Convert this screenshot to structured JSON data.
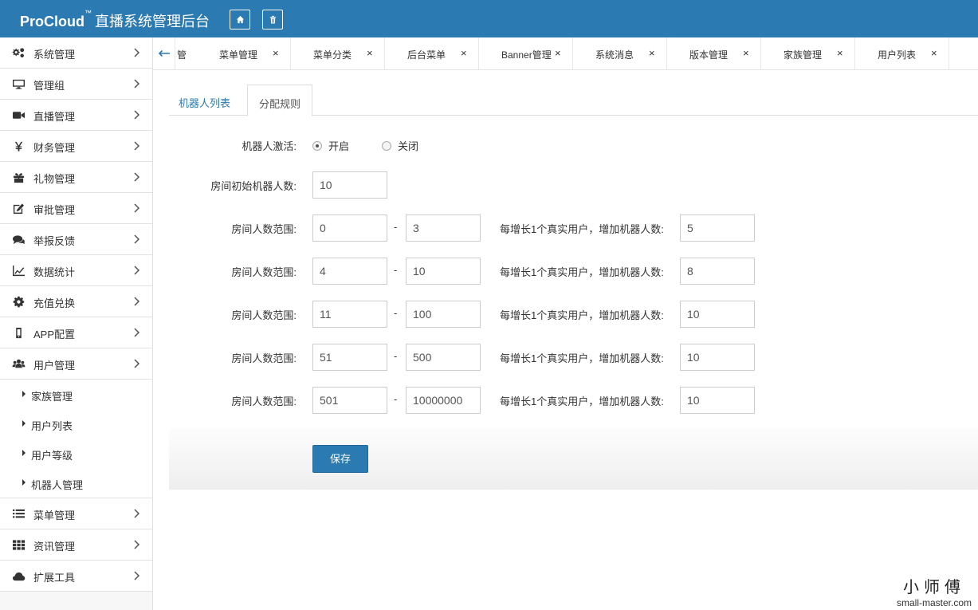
{
  "header": {
    "brand_main": "ProCloud",
    "brand_tm": "™",
    "brand_title": "直播系统管理后台",
    "home_icon": "home-icon",
    "trash_icon": "trash-icon"
  },
  "sidebar": {
    "items": [
      {
        "label": "系统管理",
        "icon": "gears-icon"
      },
      {
        "label": "管理组",
        "icon": "monitor-icon"
      },
      {
        "label": "直播管理",
        "icon": "video-camera-icon"
      },
      {
        "label": "财务管理",
        "icon": "yen-icon"
      },
      {
        "label": "礼物管理",
        "icon": "gift-icon"
      },
      {
        "label": "审批管理",
        "icon": "edit-icon"
      },
      {
        "label": "举报反馈",
        "icon": "comments-icon"
      },
      {
        "label": "数据统计",
        "icon": "line-chart-icon"
      },
      {
        "label": "充值兑换",
        "icon": "gear-icon"
      },
      {
        "label": "APP配置",
        "icon": "mobile-icon"
      },
      {
        "label": "用户管理",
        "icon": "users-icon"
      }
    ],
    "sub_items": [
      {
        "label": "家族管理"
      },
      {
        "label": "用户列表"
      },
      {
        "label": "用户等级"
      },
      {
        "label": "机器人管理"
      }
    ],
    "items_after": [
      {
        "label": "菜单管理",
        "icon": "list-icon"
      },
      {
        "label": "资讯管理",
        "icon": "grid-icon"
      },
      {
        "label": "扩展工具",
        "icon": "cloud-icon"
      }
    ]
  },
  "tabbar": {
    "partial_label": "管",
    "tabs": [
      {
        "label": "菜单管理"
      },
      {
        "label": "菜单分类"
      },
      {
        "label": "后台菜单"
      },
      {
        "label": "Banner管理"
      },
      {
        "label": "系统消息"
      },
      {
        "label": "版本管理"
      },
      {
        "label": "家族管理"
      },
      {
        "label": "用户列表"
      }
    ],
    "close_glyph": "×"
  },
  "content_tabs": {
    "robot_list": "机器人列表",
    "allocation_rules": "分配规则"
  },
  "form": {
    "activate_label": "机器人激活:",
    "opt_on": "开启",
    "opt_off": "关闭",
    "activate_value": "开启",
    "initial_label": "房间初始机器人数:",
    "initial_value": "10",
    "range_label": "房间人数范围:",
    "dash": "-",
    "increment_label": "每增长1个真实用户，增加机器人数:",
    "rows": [
      {
        "min": "0",
        "max": "3",
        "add": "5"
      },
      {
        "min": "4",
        "max": "10",
        "add": "8"
      },
      {
        "min": "11",
        "max": "100",
        "add": "10"
      },
      {
        "min": "51",
        "max": "500",
        "add": "10"
      },
      {
        "min": "501",
        "max": "10000000",
        "add": "10"
      }
    ],
    "save_label": "保存"
  },
  "watermark": {
    "line1": "小师傅",
    "line2": "small-master.com"
  },
  "colors": {
    "header_bg": "#2b7ab1",
    "primary": "#2b7ab1"
  }
}
